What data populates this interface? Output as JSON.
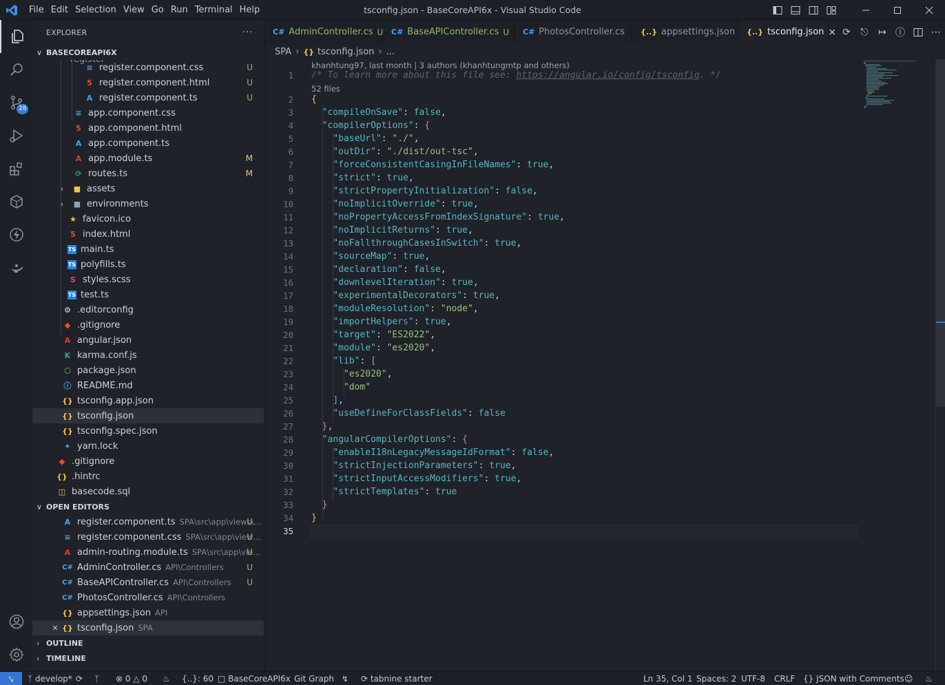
{
  "window": {
    "title": "tsconfig.json - BaseCoreAPI6x - Visual Studio Code",
    "menu": [
      "File",
      "Edit",
      "Selection",
      "View",
      "Go",
      "Run",
      "Terminal",
      "Help"
    ]
  },
  "activity": {
    "scm_badge": "28"
  },
  "sidebar": {
    "header": "EXPLORER",
    "more": "···",
    "root_section": "BASECOREAPI6X",
    "partial_folder": "register",
    "files": [
      {
        "name": "register.component.css",
        "status": "U"
      },
      {
        "name": "register.component.html",
        "status": "U"
      },
      {
        "name": "register.component.ts",
        "status": "U"
      },
      {
        "name": "app.component.css",
        "status": ""
      },
      {
        "name": "app.component.html",
        "status": ""
      },
      {
        "name": "app.component.ts",
        "status": ""
      },
      {
        "name": "app.module.ts",
        "status": "M"
      },
      {
        "name": "routes.ts",
        "status": "M"
      },
      {
        "name": "assets",
        "status": ""
      },
      {
        "name": "environments",
        "status": ""
      },
      {
        "name": "favicon.ico",
        "status": ""
      },
      {
        "name": "index.html",
        "status": ""
      },
      {
        "name": "main.ts",
        "status": ""
      },
      {
        "name": "polyfills.ts",
        "status": ""
      },
      {
        "name": "styles.scss",
        "status": ""
      },
      {
        "name": "test.ts",
        "status": ""
      },
      {
        "name": ".editorconfig",
        "status": ""
      },
      {
        "name": ".gitignore",
        "status": ""
      },
      {
        "name": "angular.json",
        "status": ""
      },
      {
        "name": "karma.conf.js",
        "status": ""
      },
      {
        "name": "package.json",
        "status": ""
      },
      {
        "name": "README.md",
        "status": ""
      },
      {
        "name": "tsconfig.app.json",
        "status": ""
      },
      {
        "name": "tsconfig.json",
        "status": ""
      },
      {
        "name": "tsconfig.spec.json",
        "status": ""
      },
      {
        "name": "yarn.lock",
        "status": ""
      },
      {
        "name": ".gitignore",
        "status": ""
      },
      {
        "name": ".hintrc",
        "status": ""
      },
      {
        "name": "basecode.sql",
        "status": ""
      }
    ],
    "open_editors_section": "OPEN EDITORS",
    "open_editors": [
      {
        "name": "register.component.ts",
        "path": "SPA\\src\\app\\views\\r...",
        "status": "U"
      },
      {
        "name": "register.component.css",
        "path": "SPA\\src\\app\\views...",
        "status": "U"
      },
      {
        "name": "admin-routing.module.ts",
        "path": "SPA\\src\\app\\vie...",
        "status": "U"
      },
      {
        "name": "AdminController.cs",
        "path": "API\\Controllers",
        "status": "U"
      },
      {
        "name": "BaseAPIController.cs",
        "path": "API\\Controllers",
        "status": "U"
      },
      {
        "name": "PhotosController.cs",
        "path": "API\\Controllers",
        "status": ""
      },
      {
        "name": "appsettings.json",
        "path": "API",
        "status": ""
      },
      {
        "name": "tsconfig.json",
        "path": "SPA",
        "status": ""
      }
    ],
    "outline_section": "OUTLINE",
    "timeline_section": "TIMELINE"
  },
  "tabs": [
    {
      "label": "AdminController.cs",
      "icon": "C#",
      "status": "U"
    },
    {
      "label": "BaseAPIController.cs",
      "icon": "C#",
      "status": "U"
    },
    {
      "label": "PhotosController.cs",
      "icon": "C#",
      "status": ""
    },
    {
      "label": "appsettings.json",
      "icon": "{..}",
      "status": ""
    },
    {
      "label": "tsconfig.json",
      "icon": "{..}",
      "status": "×"
    }
  ],
  "breadcrumb": {
    "folder": "SPA",
    "file": "tsconfig.json",
    "more": "..."
  },
  "editor": {
    "lens_blame": "khanhtung97, last month | 3 authors (khanhtungmtp and others)",
    "lens_files": "52 files",
    "line_numbers": [
      "1",
      "2",
      "3",
      "4",
      "5",
      "6",
      "7",
      "8",
      "9",
      "10",
      "11",
      "12",
      "13",
      "14",
      "15",
      "16",
      "17",
      "18",
      "19",
      "20",
      "21",
      "22",
      "23",
      "24",
      "25",
      "26",
      "27",
      "28",
      "29",
      "30",
      "31",
      "32",
      "33",
      "34",
      "35"
    ],
    "line1_comment_a": "/* To learn more about this file see: ",
    "line1_link": "https://angular.io/config/tsconfig",
    "line1_comment_b": ". */"
  },
  "status": {
    "branch": "develop*",
    "errors": "0",
    "warnings": "0",
    "json_count": "{..}: 60",
    "project": "BaseCoreAPI6x",
    "git_graph": "Git Graph",
    "tabnine": "tabnine starter",
    "position": "Ln 35, Col 1",
    "spaces": "Spaces: 2",
    "encoding": "UTF-8",
    "eol": "CRLF",
    "language": "JSON with Comments"
  },
  "colors": {
    "accent": "#3576d4",
    "bg": "#1f2229",
    "keys": "#56b6c2",
    "strings": "#98c379"
  }
}
